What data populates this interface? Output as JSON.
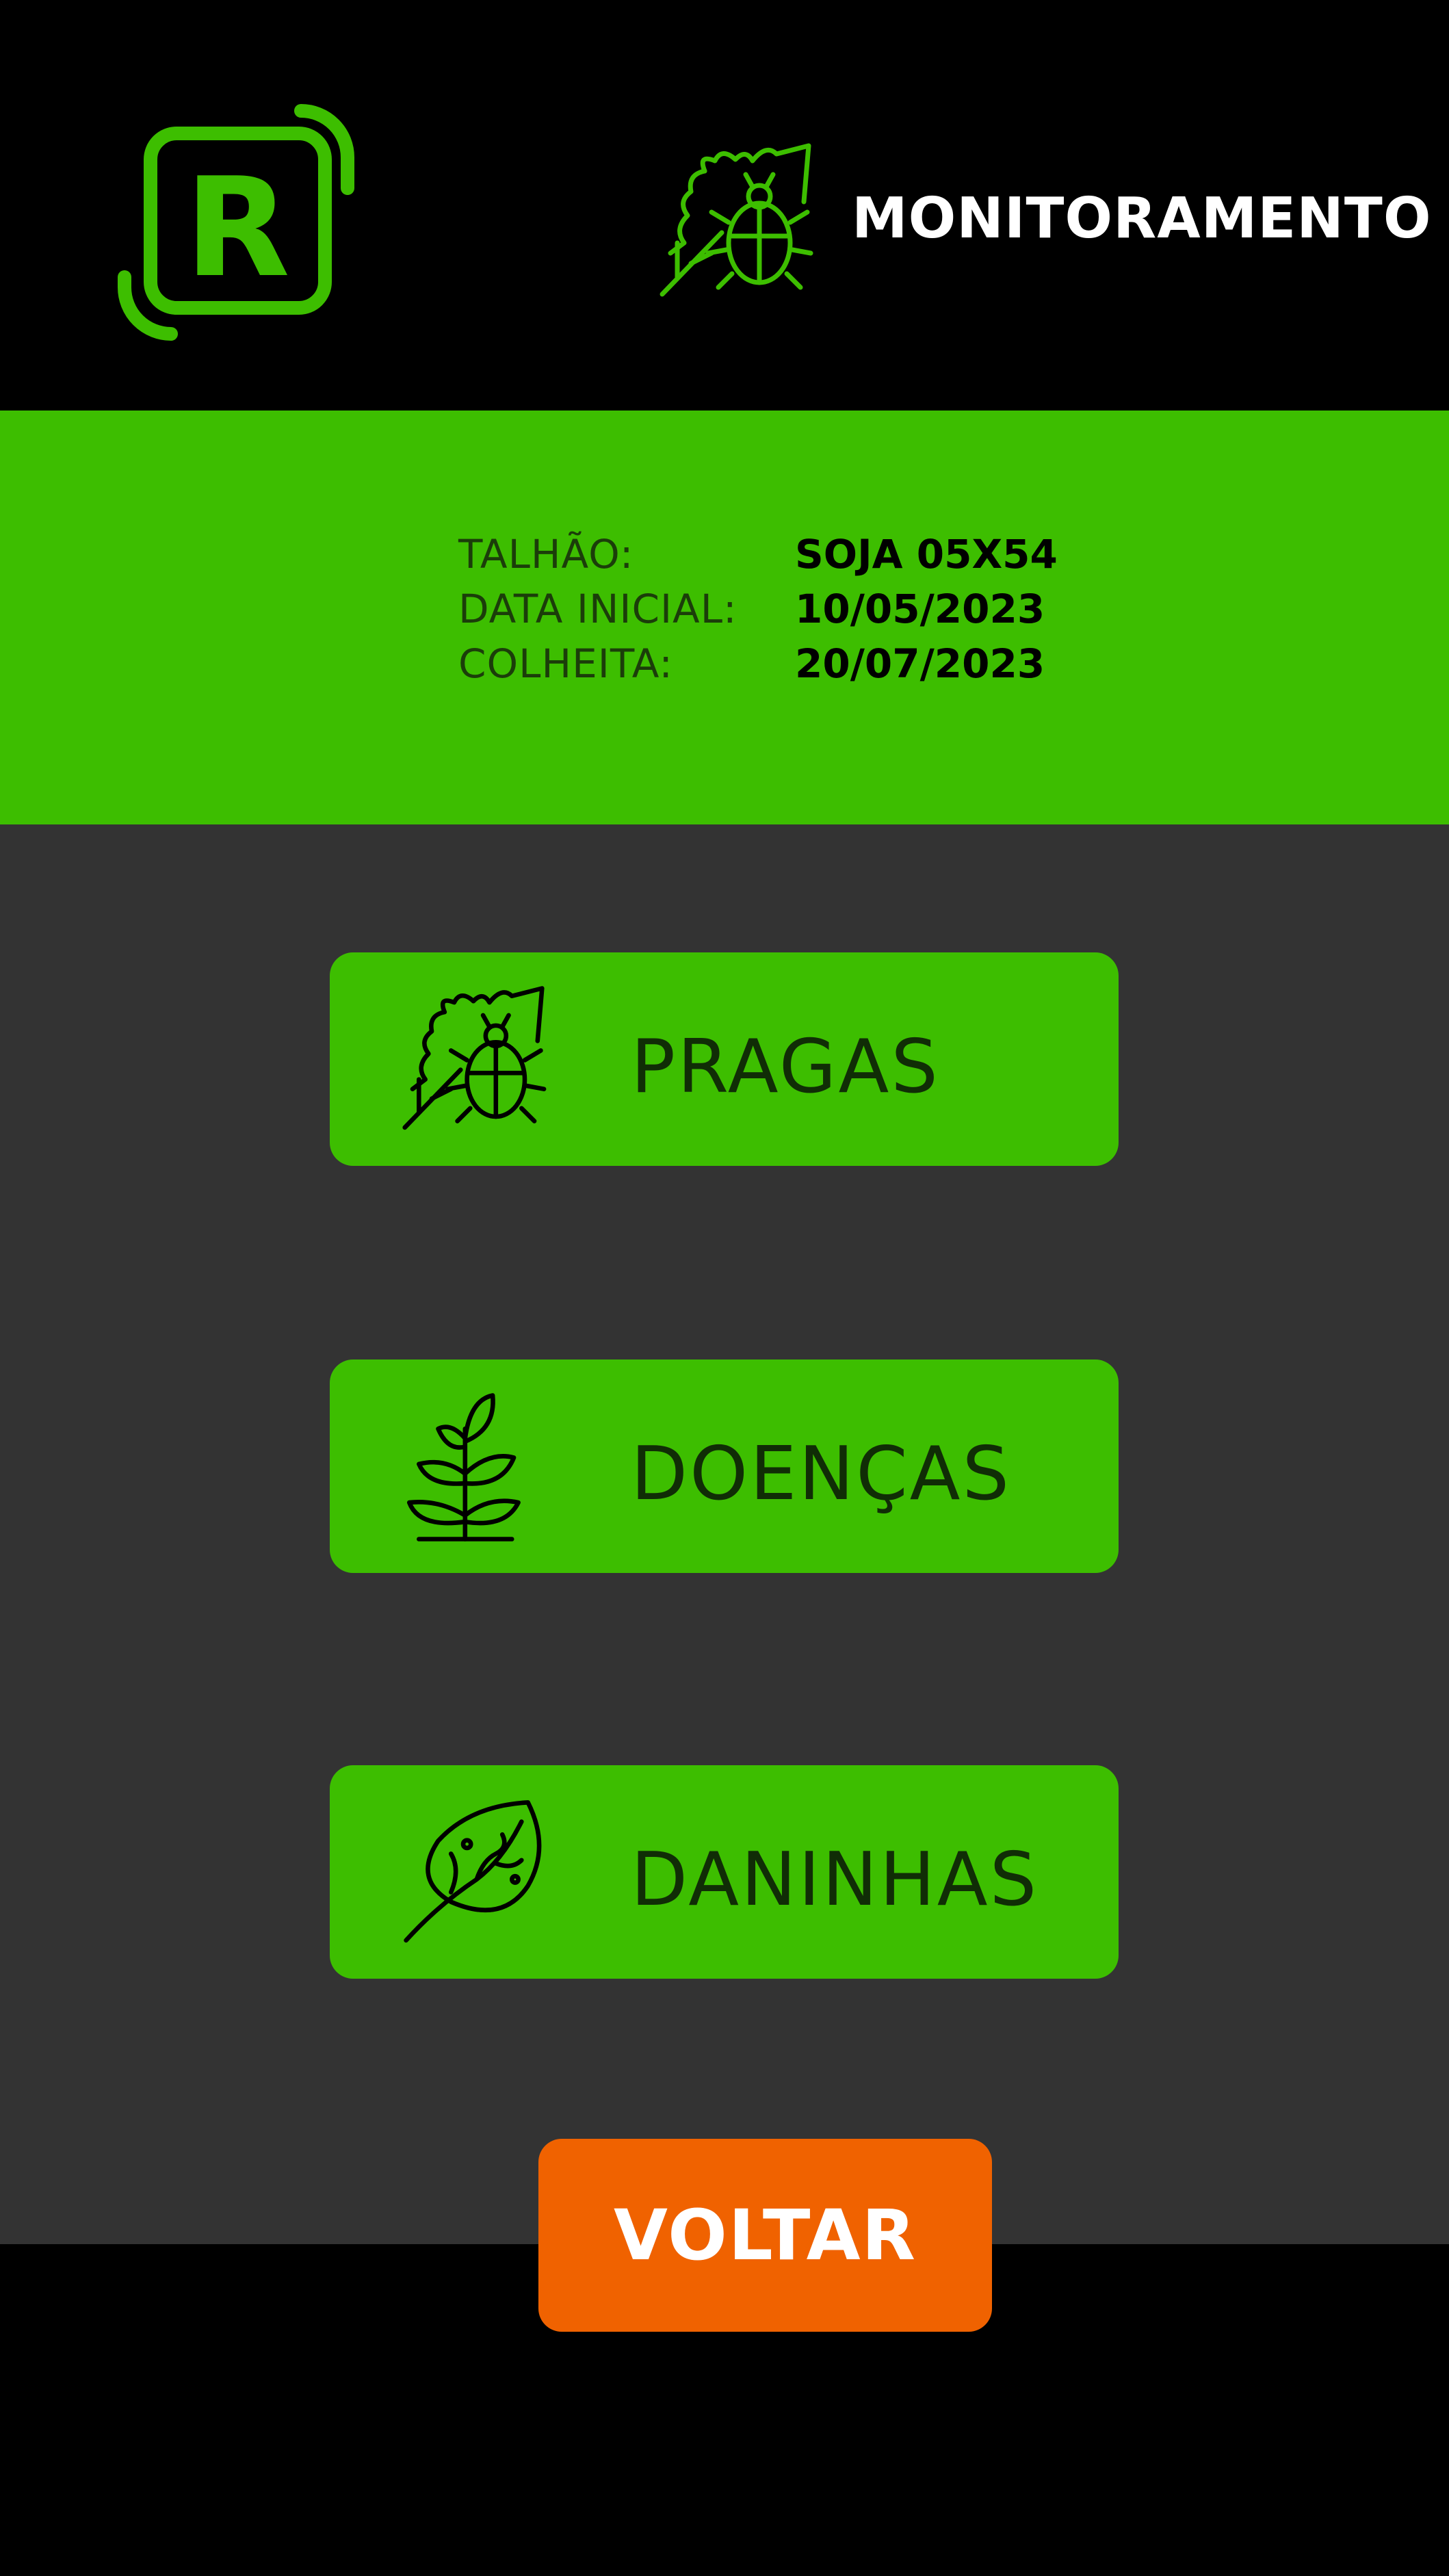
{
  "header": {
    "title": "MONITORAMENTO",
    "logo_icon": "r-logo-icon",
    "title_icon": "pest-bug-icon"
  },
  "info": {
    "icon": "layers-icon",
    "rows": [
      {
        "label": "TALHÃO:",
        "value": "SOJA 05X54"
      },
      {
        "label": "DATA INICIAL:",
        "value": "10/05/2023"
      },
      {
        "label": "COLHEITA:",
        "value": "20/07/2023"
      }
    ]
  },
  "menu": [
    {
      "label": "PRAGAS",
      "icon": "pest-bug-icon"
    },
    {
      "label": "DOENÇAS",
      "icon": "plant-icon"
    },
    {
      "label": "DANINHAS",
      "icon": "leaf-icon"
    }
  ],
  "back_button": {
    "label": "VOLTAR"
  },
  "colors": {
    "accent_green": "#3dbe00",
    "background_dark": "#333333",
    "background_black": "#000000",
    "back_orange": "#f06200"
  }
}
